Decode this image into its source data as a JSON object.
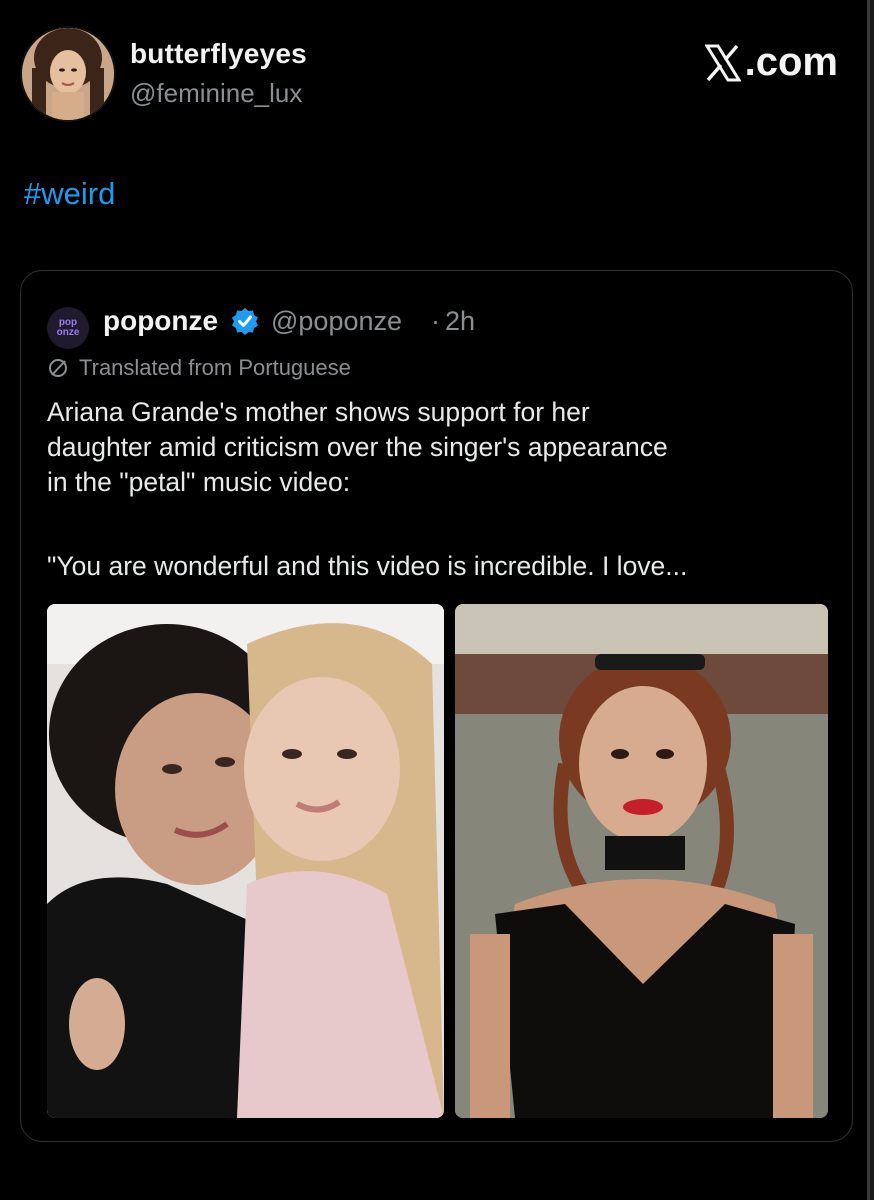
{
  "header": {
    "display_name": "butterflyeyes",
    "handle": "@feminine_lux",
    "site_label": ".com"
  },
  "tweet": {
    "hashtag": "#weird"
  },
  "quoted": {
    "logo_text_top": "pop",
    "logo_text_bottom": "onze",
    "author_name": "poponze",
    "author_handle": "@poponze",
    "separator": "·",
    "time": "2h",
    "translated_label": "Translated from Portuguese",
    "text_lines": [
      "Ariana Grande's mother shows support for her",
      "daughter amid criticism over the singer's appearance",
      "in the \"petal\" music video:"
    ],
    "quote_line": "\"You are wonderful and this video is incredible. I love...",
    "media": [
      {
        "icon": "photo-mother-daughter-selfie"
      },
      {
        "icon": "photo-music-video-still"
      }
    ]
  },
  "colors": {
    "background": "#000000",
    "hashtag": "#1d9bf0",
    "verified": "#1d9bf0",
    "muted_text": "#8b8f94",
    "border": "#2f3336"
  }
}
